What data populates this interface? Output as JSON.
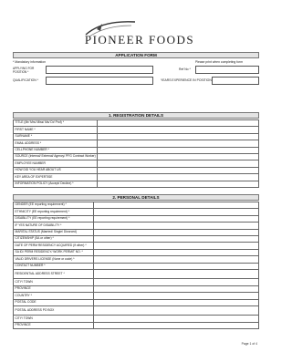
{
  "header": {
    "logo_text": "PIONEER FOODS"
  },
  "form_title": "APPLICATION FORM",
  "notes": {
    "mandatory": "* Mandatory information",
    "print": "Please print when completing form"
  },
  "top_fields": {
    "applying_label": "APPLYING FOR POSITION *",
    "ref_label": "Ref No *",
    "qualification_label": "QUALIFICATION *",
    "years_label": "YEARS EXPERIENCE IN POSITION *"
  },
  "registration": {
    "title": "1. REGISTRATION DETAILS",
    "rows": [
      "TITLE (Mr/ Mrs/ Miss/ Ms/ Dr/ Prof) *",
      "FIRST NAME *",
      "SURNAME *",
      "EMAIL ADDRESS *",
      "CELLPHONE NUMBER *",
      "SOURCE (Internal/ External/ Agency/ PFG Contract Worker)",
      "EMPLOYEE NUMBER",
      "HOW DID YOU HEAR ABOUT US",
      "KEY AREA OF EXPERTISE",
      "INFORMATION POLICY (Accept/ Decline) *"
    ]
  },
  "personal": {
    "title": "2. PERSONAL DETAILS",
    "rows": [
      "GENDER (EE reporting requirement) *",
      "ETHNICITY (EE reporting requirement) *",
      "DISABILITY (EE reporting requirement) *",
      "IF YES NATURE OF DISABILITY *",
      "MARITAL STATUS (Married/ Single/ Divorced)",
      "CITIZENSHIP (SA or other) *",
      "DATE OF PERM RESIDENCY ACQUIRED (if other) *",
      "SA ID/ PERM RESIDENCY/ WORK PERMIT NO. *",
      "VALID DRIVERS LICENSE (None or code) *",
      "CONTACT NUMBER *",
      "RESIDENTIAL ADDRESS STREET *",
      "CITY/ TOWN",
      "PROVINCE",
      "COUNTRY *",
      "POSTAL CODE",
      "POSTAL ADDRESS PO BOX",
      "CITY/ TOWN",
      "PROVINCE"
    ]
  },
  "footer": {
    "page": "Page 1 of 4"
  }
}
